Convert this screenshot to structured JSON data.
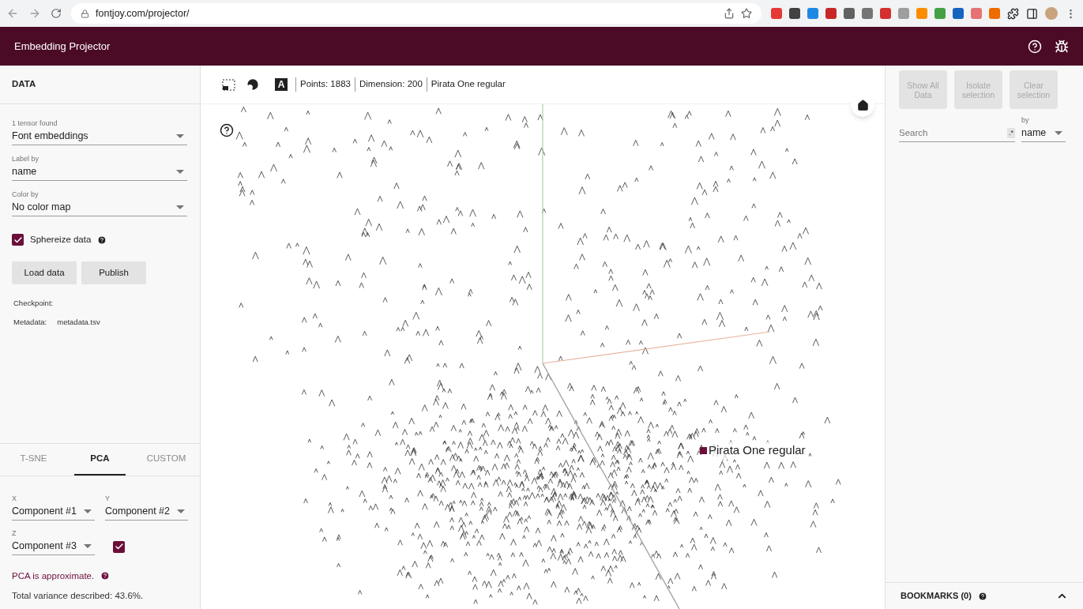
{
  "browser": {
    "url": "fontjoy.com/projector/"
  },
  "app": {
    "title": "Embedding Projector"
  },
  "data_panel": {
    "title": "DATA",
    "tensor": {
      "label": "1 tensor found",
      "value": "Font embeddings"
    },
    "label_by": {
      "label": "Label by",
      "value": "name"
    },
    "color_by": {
      "label": "Color by",
      "value": "No color map"
    },
    "sphereize": {
      "label": "Sphereize data",
      "checked": true
    },
    "buttons": [
      "Load data",
      "Publish"
    ],
    "checkpoint": {
      "label": "Checkpoint:"
    },
    "metadata": {
      "label": "Metadata:",
      "value": "metadata.tsv"
    }
  },
  "projection_tabs": [
    {
      "label": "T-SNE",
      "selected": false
    },
    {
      "label": "PCA",
      "selected": true
    },
    {
      "label": "CUSTOM",
      "selected": false
    }
  ],
  "pca": {
    "x": {
      "label": "X",
      "value": "Component #1"
    },
    "y": {
      "label": "Y",
      "value": "Component #2"
    },
    "z": {
      "label": "Z",
      "value": "Component #3"
    },
    "z_enabled": true,
    "note": "PCA is approximate.",
    "variance": "Total variance described: 43.6%."
  },
  "toolbar": {
    "label_glyph": "A",
    "stats": [
      "Points: 1883",
      "Dimension: 200",
      "Pirata One regular"
    ]
  },
  "plot": {
    "selected_label": "Pirata One regular"
  },
  "inspector": {
    "buttons": [
      {
        "label": "Show All Data",
        "disabled": true
      },
      {
        "label": "Isolate selection",
        "disabled": true
      },
      {
        "label": "Clear selection",
        "disabled": true
      }
    ],
    "search": {
      "placeholder": "Search",
      "regex_toggle": ".*"
    },
    "by": {
      "label": "by",
      "value": "name"
    },
    "bookmarks": {
      "title": "BOOKMARKS (0)"
    }
  }
}
